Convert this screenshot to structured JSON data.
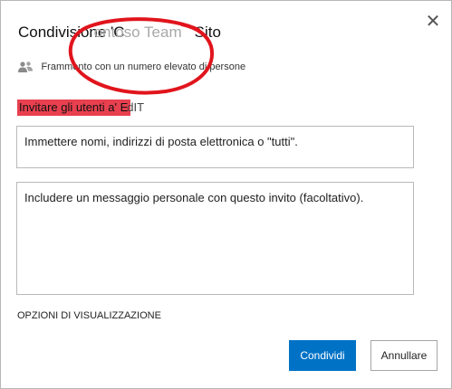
{
  "dialog": {
    "title_main": "Condivisione 'C",
    "title_ghost": "ontoso Team",
    "title_site": "Sito",
    "close_glyph": "✕"
  },
  "people_info": {
    "icon": "people-icon",
    "text": "Frammento con un numero elevato di persone"
  },
  "invite": {
    "label": "Invitare gli utenti a' E",
    "label_suffix": "dIT",
    "names_placeholder": "Immettere nomi, indirizzi di posta elettronica o \"tutti\".",
    "message_placeholder": "Includere un messaggio personale con questo invito (facoltativo)."
  },
  "options": {
    "label": "OPZIONI DI VISUALIZZAZIONE"
  },
  "buttons": {
    "share": "Condividi",
    "cancel": "Annullare"
  },
  "colors": {
    "accent": "#0072c6",
    "highlight": "#e8404f",
    "annotation": "#e1141c"
  }
}
